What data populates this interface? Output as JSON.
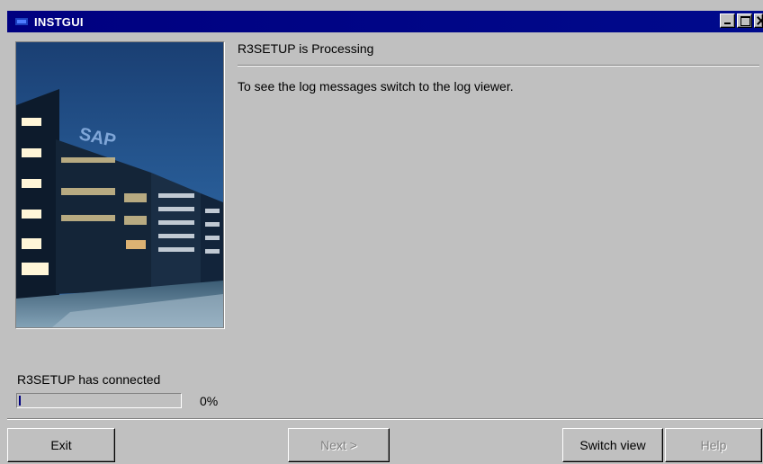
{
  "window": {
    "title": "INSTGUI",
    "accent": "#000080"
  },
  "main": {
    "heading": "R3SETUP is Processing",
    "message": "To see the log messages switch to the log viewer."
  },
  "image": {
    "sign_text": "SAP"
  },
  "status": {
    "text": "R3SETUP has connected",
    "progress_fraction": 0.01,
    "progress_label": "0%"
  },
  "buttons": {
    "exit": "Exit",
    "next": "Next >",
    "switch_view": "Switch view",
    "help": "Help"
  }
}
